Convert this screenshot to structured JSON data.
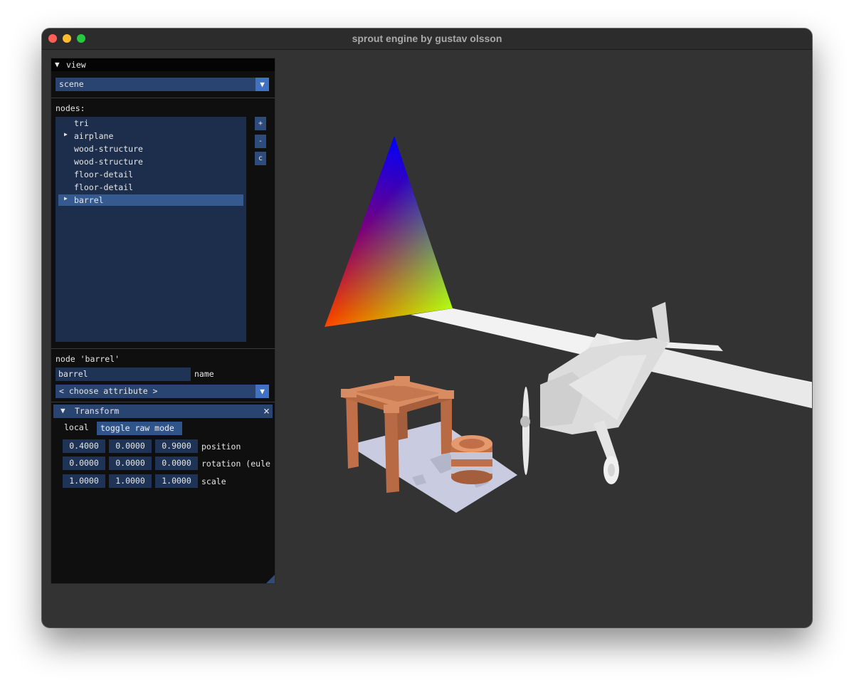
{
  "window": {
    "title": "sprout engine by gustav olsson"
  },
  "panel": {
    "header": "view",
    "view_combo": "scene",
    "nodes_label": "nodes:",
    "nodes": [
      {
        "label": "tri",
        "expandable": false,
        "selected": false
      },
      {
        "label": "airplane",
        "expandable": true,
        "selected": false
      },
      {
        "label": "wood-structure",
        "expandable": false,
        "selected": false
      },
      {
        "label": "wood-structure",
        "expandable": false,
        "selected": false
      },
      {
        "label": "floor-detail",
        "expandable": false,
        "selected": false
      },
      {
        "label": "floor-detail",
        "expandable": false,
        "selected": false
      },
      {
        "label": "barrel",
        "expandable": true,
        "selected": true
      }
    ],
    "side_buttons": [
      "+",
      "-",
      "c"
    ],
    "node_title": "node 'barrel'",
    "name_value": "barrel",
    "name_label": "name",
    "attribute_combo": "< choose attribute >",
    "transform": {
      "header": "Transform",
      "mode_label": "local",
      "toggle_button": "toggle raw mode",
      "rows": [
        {
          "values": [
            "0.4000",
            "0.0000",
            "0.9000"
          ],
          "label": "position"
        },
        {
          "values": [
            "0.0000",
            "0.0000",
            "0.0000"
          ],
          "label": "rotation (eule"
        },
        {
          "values": [
            "1.0000",
            "1.0000",
            "1.0000"
          ],
          "label": "scale"
        }
      ]
    }
  },
  "icons": {
    "expand": "triangle-down-icon",
    "tree_expand": "triangle-right-icon",
    "close": "close-icon"
  },
  "colors": {
    "background": "#333333",
    "accent": "#294470",
    "selection": "#345a8f"
  }
}
